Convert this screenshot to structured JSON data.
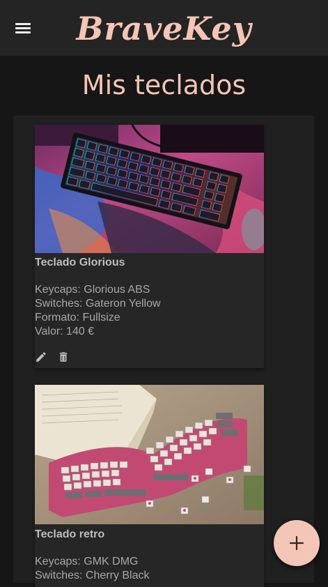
{
  "app": {
    "brand": "BraveKey",
    "menu_icon": "hamburger-menu-icon"
  },
  "page": {
    "title": "Mis teclados"
  },
  "colors": {
    "accent": "#f5c5b5",
    "topbar": "#242424",
    "background": "#161616",
    "panel": "#202020",
    "card": "#262626",
    "fab": "#f3c6b8"
  },
  "keyboards": [
    {
      "name": "Teclado Glorious",
      "keycaps": "Keycaps: Glorious ABS",
      "switches": "Switches: Gateron Yellow",
      "format": "Formato: Fullsize",
      "value": "Valor: 140 €",
      "image": "rgb-keyboard-on-pink-artwork-mousepad",
      "edit_icon": "pencil-icon",
      "delete_icon": "trash-icon"
    },
    {
      "name": "Teclado retro",
      "keycaps": "Keycaps: GMK DMG",
      "switches": "Switches: Cherry Black",
      "image": "pink-alice-layout-keyboard-with-retro-keycaps"
    }
  ],
  "fab": {
    "icon": "plus-icon"
  }
}
